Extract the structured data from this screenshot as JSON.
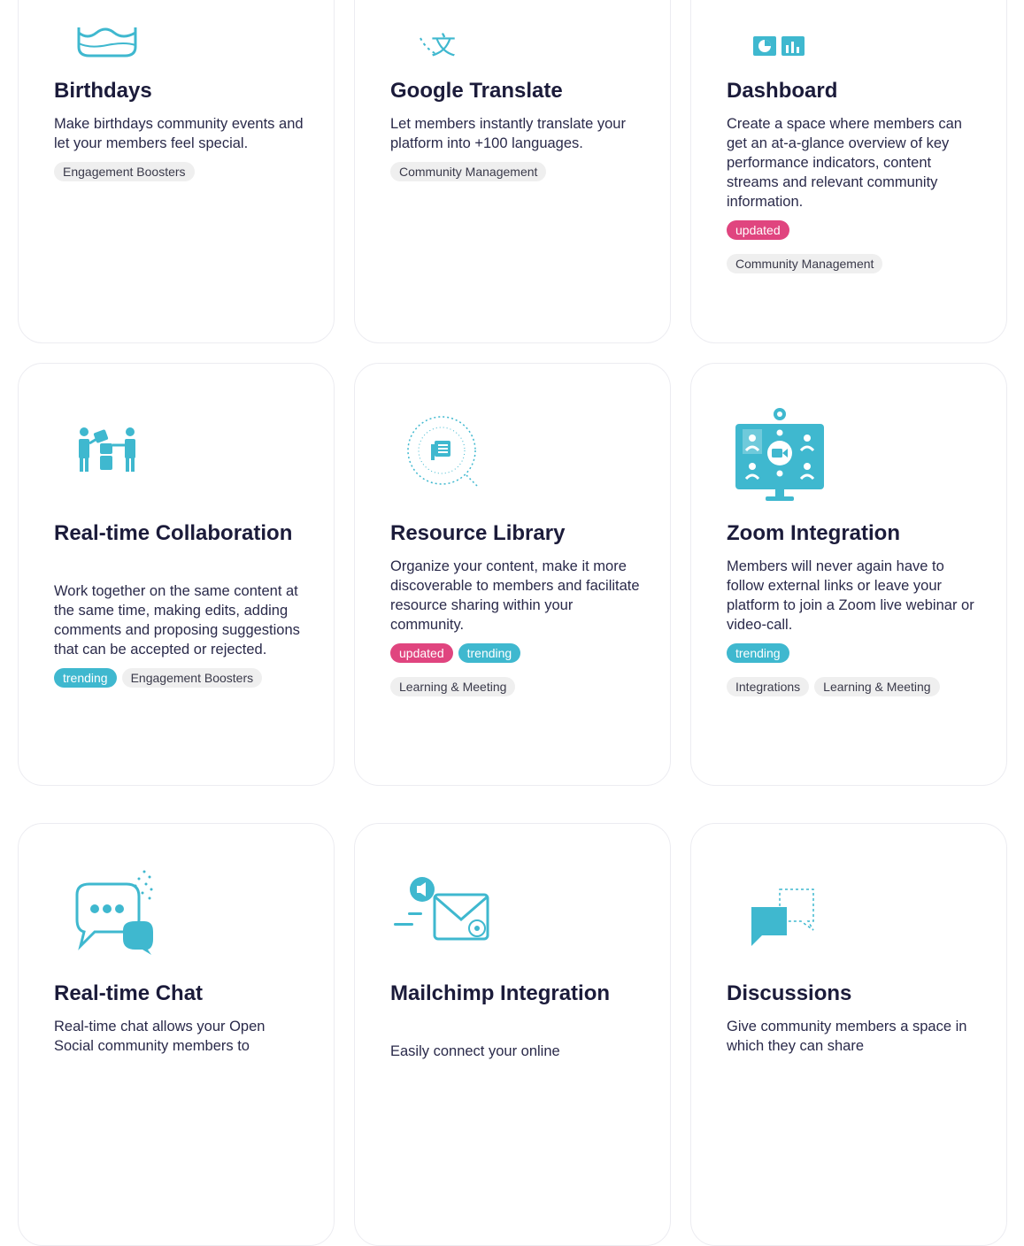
{
  "colors": {
    "accent_teal": "#3fb8cf",
    "updated_pink": "#e0457f",
    "title_navy": "#1b1b3a",
    "tag_gray": "#efefef"
  },
  "cards": [
    {
      "icon": "birthday-cake-icon",
      "title": "Birthdays",
      "description": "Make birthdays community events and let your members feel special.",
      "badges": [],
      "tags": [
        "Engagement Boosters"
      ]
    },
    {
      "icon": "translate-icon",
      "title": "Google Translate",
      "description": "Let members instantly translate your platform into +100 languages.",
      "badges": [],
      "tags": [
        "Community Management"
      ]
    },
    {
      "icon": "dashboard-charts-icon",
      "title": "Dashboard",
      "description": "Create a space where members can get an at-a-glance overview of key performance indicators, content streams and relevant community information.",
      "badges": [
        "updated"
      ],
      "tags": [
        "Community Management"
      ]
    },
    {
      "icon": "collaboration-people-icon",
      "title": "Real-time Collaboration",
      "description": "Work together on the same content at the same time, making edits, adding comments and proposing suggestions that can be accepted or rejected.",
      "badges": [
        "trending"
      ],
      "tags": [
        "Engagement Boosters"
      ]
    },
    {
      "icon": "resource-library-search-icon",
      "title": "Resource Library",
      "description": "Organize your content, make it more discoverable to members and facilitate resource sharing within your community.",
      "badges": [
        "updated",
        "trending"
      ],
      "tags": [
        "Learning & Meeting"
      ]
    },
    {
      "icon": "video-conference-monitor-icon",
      "title": "Zoom Integration",
      "description": "Members will never again have to follow external links or leave your platform to join a Zoom live webinar or video-call.",
      "badges": [
        "trending"
      ],
      "tags": [
        "Integrations",
        "Learning & Meeting"
      ]
    },
    {
      "icon": "chat-bubbles-icon",
      "title": "Real-time Chat",
      "description": "Real-time chat allows your Open Social community members to",
      "badges": [],
      "tags": []
    },
    {
      "icon": "mail-envelope-icon",
      "title": "Mailchimp Integration",
      "description": "Easily connect your online",
      "badges": [],
      "tags": []
    },
    {
      "icon": "discussion-bubbles-icon",
      "title": "Discussions",
      "description": "Give community members a space in which they can share",
      "badges": [],
      "tags": []
    }
  ]
}
